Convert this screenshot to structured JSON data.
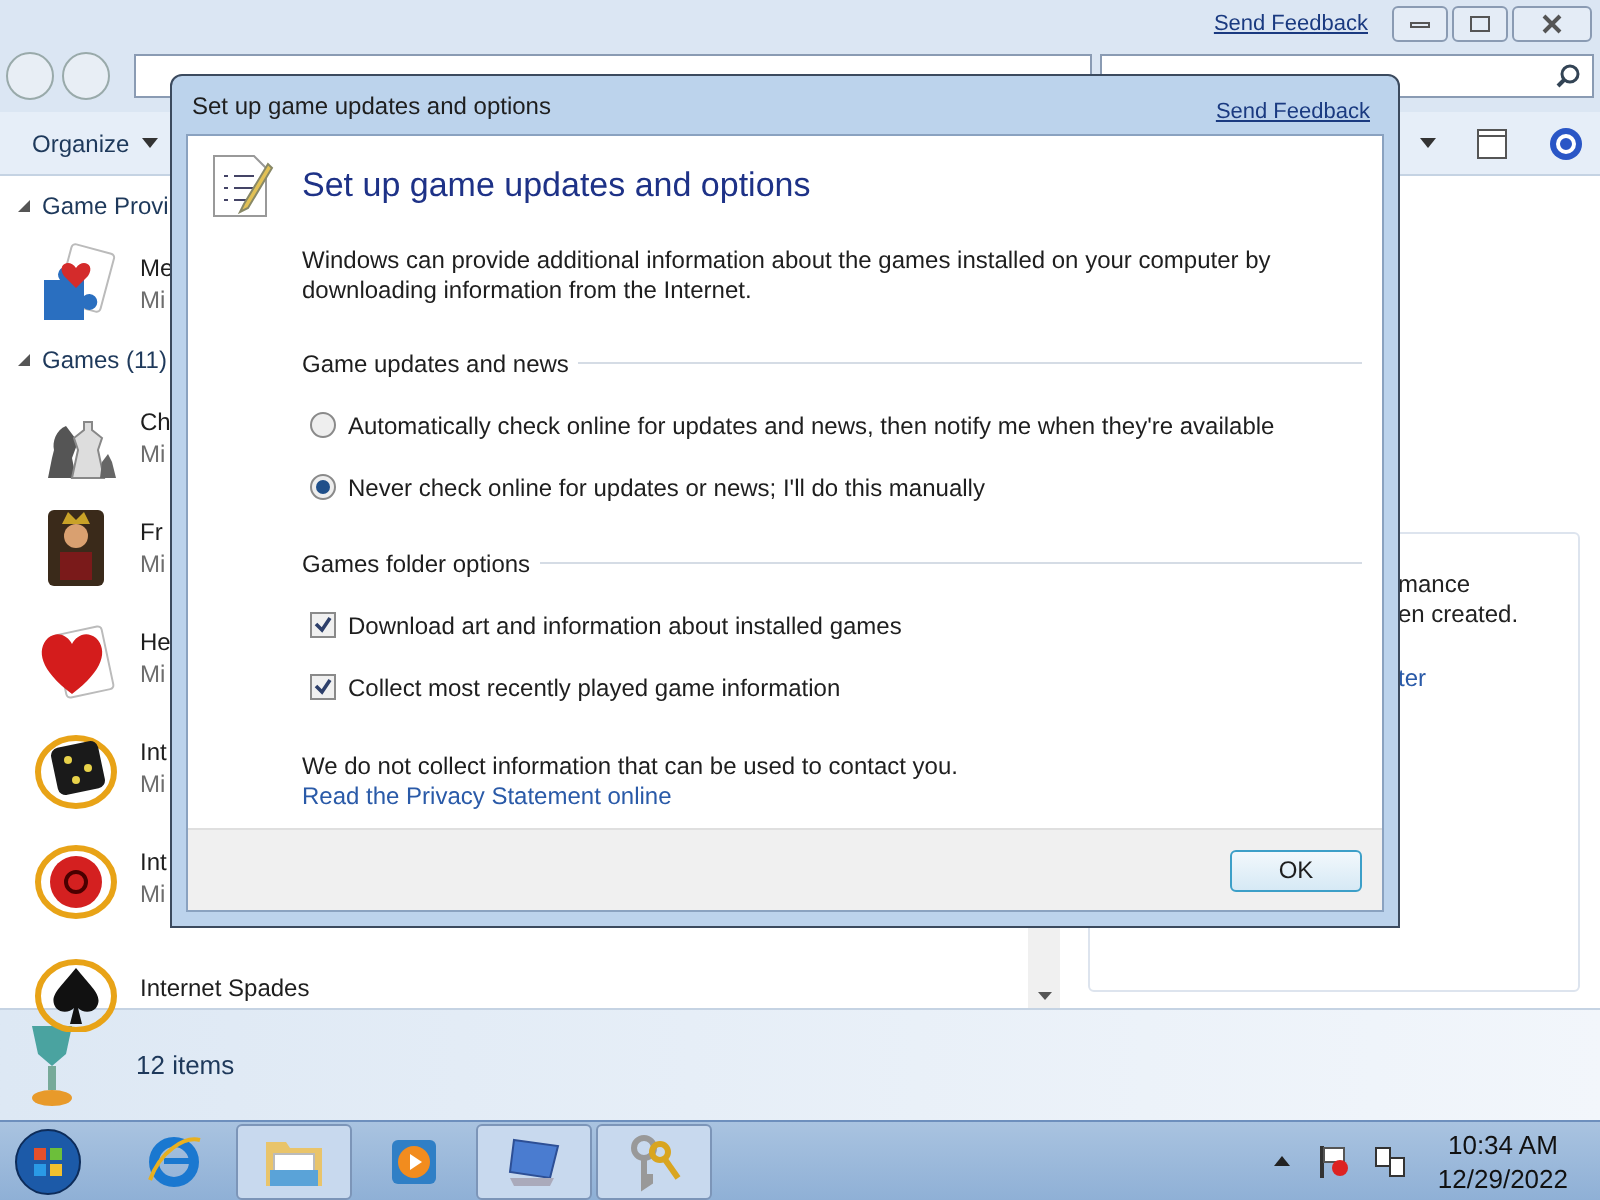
{
  "explorer": {
    "send_feedback": "Send Feedback",
    "toolbar": {
      "organize": "Organize"
    },
    "groups": [
      {
        "title": "Game Provi",
        "expanded": true,
        "items": [
          {
            "name": "Me",
            "publisher": "Mi",
            "kind": "puzzle"
          }
        ]
      },
      {
        "title": "Games (11)",
        "expanded": true,
        "items": [
          {
            "name": "Ch",
            "publisher": "Mi",
            "kind": "chess"
          },
          {
            "name": "Fr",
            "publisher": "Mi",
            "kind": "king"
          },
          {
            "name": "He",
            "publisher": "Mi",
            "kind": "heart"
          },
          {
            "name": "Int",
            "publisher": "Mi",
            "kind": "dice"
          },
          {
            "name": "Int",
            "publisher": "Mi",
            "kind": "ball"
          },
          {
            "name": "Internet Spades",
            "kind": "spade"
          }
        ]
      }
    ],
    "details_pane": {
      "lines": [
        "mance",
        "en created."
      ],
      "link": "ter"
    },
    "status": "12 items"
  },
  "dialog": {
    "title": "Set up game updates and options",
    "send_feedback": "Send Feedback",
    "heading": "Set up game updates and options",
    "intro": "Windows can provide additional information about the games installed on your computer by downloading information from the Internet.",
    "sections": [
      {
        "title": "Game updates and news",
        "options": [
          {
            "kind": "radio",
            "label": "Automatically check online for updates and news, then notify me when they're available",
            "selected": false
          },
          {
            "kind": "radio",
            "label": "Never check online for updates or news; I'll do this manually",
            "selected": true
          }
        ]
      },
      {
        "title": "Games folder options",
        "options": [
          {
            "kind": "checkbox",
            "label": "Download art and information about installed games",
            "checked": true
          },
          {
            "kind": "checkbox",
            "label": "Collect most recently played game information",
            "checked": true
          }
        ]
      }
    ],
    "note": "We do not collect information that can be used to contact you.",
    "privacy_link": "Read the Privacy Statement online",
    "ok": "OK"
  },
  "taskbar": {
    "apps": [
      {
        "kind": "ie",
        "open": false
      },
      {
        "kind": "folder",
        "open": true
      },
      {
        "kind": "media",
        "open": false
      },
      {
        "kind": "remote",
        "open": true
      },
      {
        "kind": "keys",
        "open": true
      }
    ],
    "time": "10:34 AM",
    "date": "12/29/2022"
  }
}
